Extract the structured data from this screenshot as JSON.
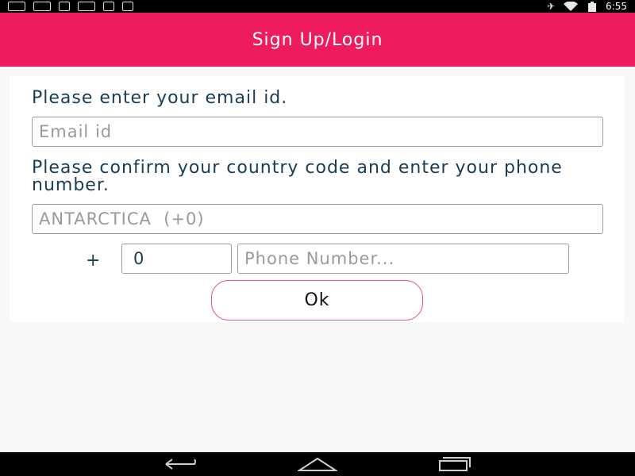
{
  "status_bar": {
    "time": "6:55",
    "left_icons": [
      "notification-icon-1",
      "message-icon",
      "download-icon",
      "youtube-icon",
      "flag-icon",
      "barcode-icon"
    ],
    "right_icons": [
      "airplane-mute-icon",
      "wifi-icon",
      "battery-icon"
    ]
  },
  "app_bar": {
    "title": "Sign Up/Login",
    "color": "#ef1b5f"
  },
  "form": {
    "email_prompt": "Please enter your email id.",
    "email_placeholder": "Email id",
    "country_prompt": "Please confirm your country code and enter your phone number.",
    "country_value": "ANTARCTICA  (+0)",
    "plus_sign": "+",
    "country_code": "0",
    "phone_placeholder": "Phone Number...",
    "ok_label": "Ok"
  },
  "nav_bar": {
    "buttons": [
      "back-icon",
      "home-icon",
      "recent-apps-icon"
    ]
  }
}
